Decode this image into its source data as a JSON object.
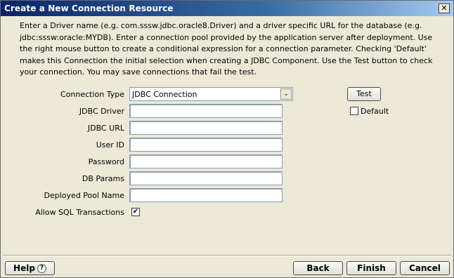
{
  "window": {
    "title": "Create a New Connection Resource",
    "close_glyph": "✕"
  },
  "description": "Enter a Driver name (e.g. com.sssw.jdbc.oracle8.Driver) and a driver specific URL for the database (e.g. jdbc:sssw:oracle:MYDB). Enter a connection pool provided by the application server after deployment. Use the right mouse button to create a conditional expression for a connection parameter. Checking 'Default' makes this Connection the initial selection when creating a JDBC Component. Use the Test button to check your connection. You may save connections that fail the test.",
  "form": {
    "connection_type_label": "Connection Type",
    "connection_type_value": "JDBC Connection",
    "jdbc_driver_label": "JDBC Driver",
    "jdbc_driver_value": "",
    "jdbc_url_label": "JDBC URL",
    "jdbc_url_value": "",
    "user_id_label": "User ID",
    "user_id_value": "",
    "password_label": "Password",
    "password_value": "",
    "db_params_label": "DB Params",
    "db_params_value": "",
    "deployed_pool_label": "Deployed Pool Name",
    "deployed_pool_value": "",
    "allow_sql_label": "Allow SQL Transactions",
    "allow_sql_checked": "✔"
  },
  "side": {
    "test_label": "Test",
    "default_label": "Default",
    "default_checked": ""
  },
  "footer": {
    "help_label": "Help",
    "help_glyph": "?",
    "back_label": "Back",
    "finish_label": "Finish",
    "cancel_label": "Cancel"
  }
}
